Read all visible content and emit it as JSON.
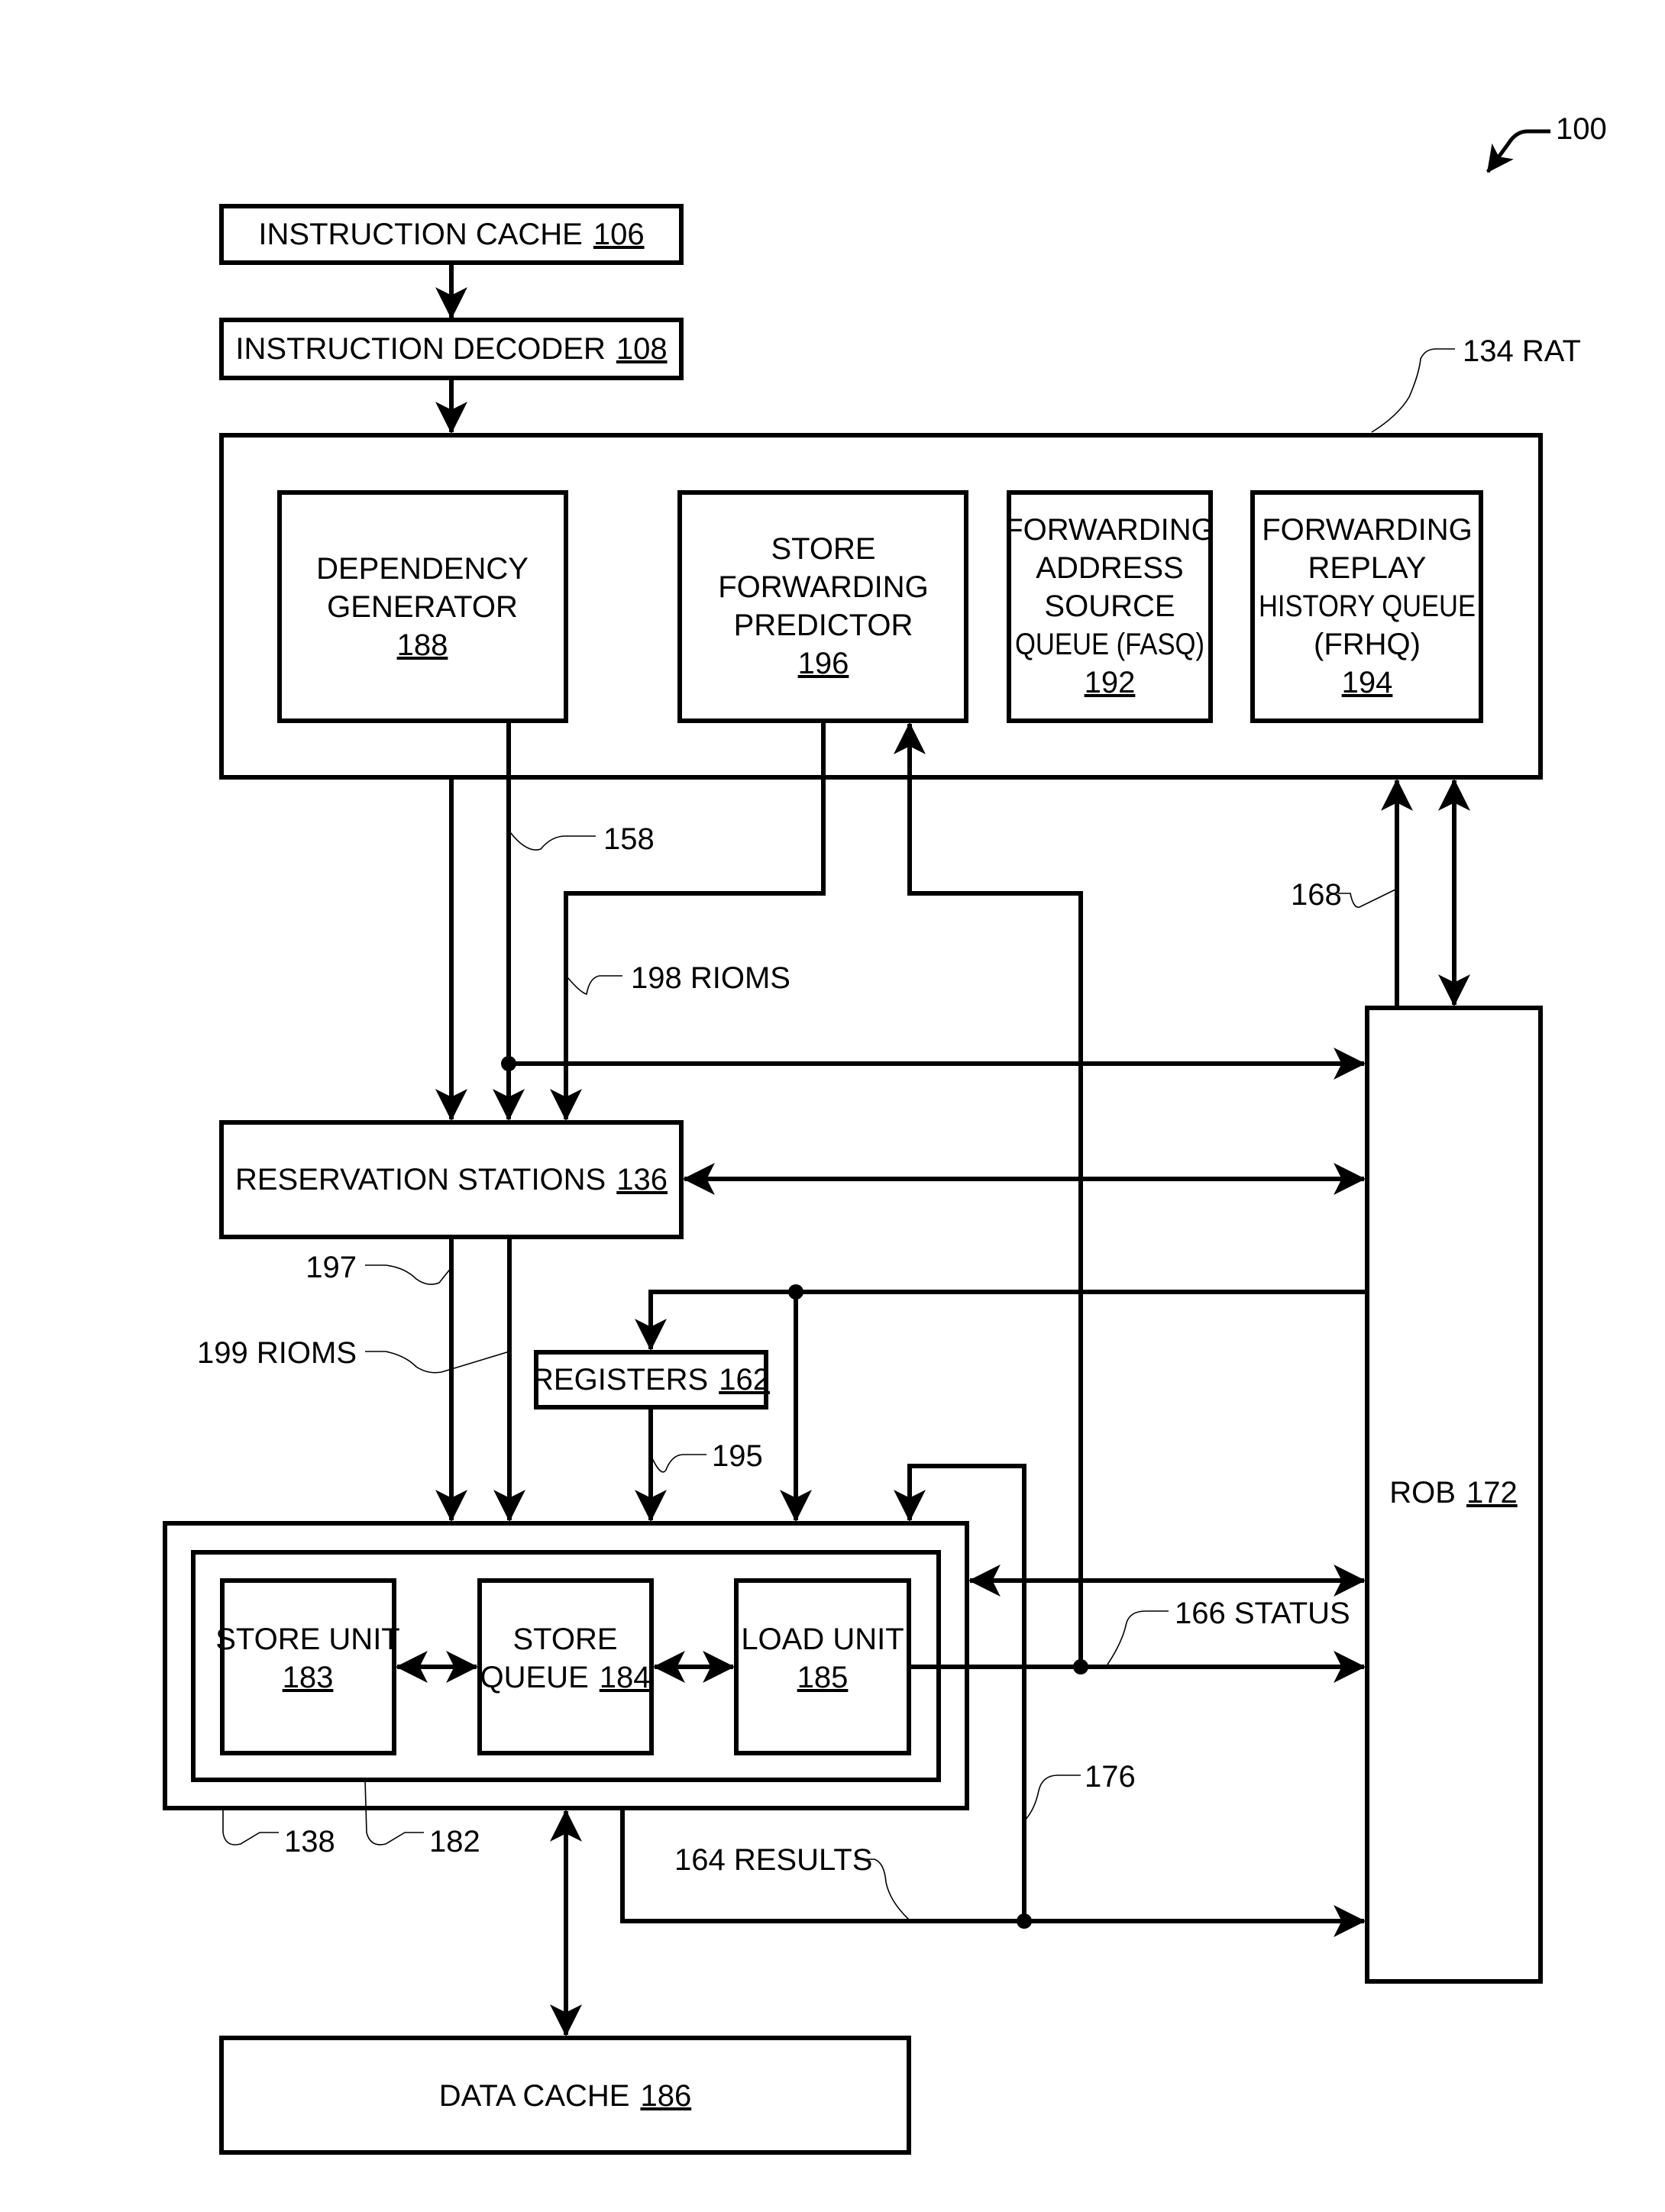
{
  "figure": {
    "figure_number": "100",
    "colors": {
      "line": "#000000",
      "background": "#ffffff"
    }
  },
  "blocks": {
    "instruction_cache": {
      "label": "INSTRUCTION CACHE",
      "ref": "106"
    },
    "instruction_decoder": {
      "label": "INSTRUCTION DECODER",
      "ref": "108"
    },
    "rat": {
      "callout": "134  RAT"
    },
    "dependency_generator": {
      "lines": [
        "DEPENDENCY",
        "GENERATOR"
      ],
      "ref": "188"
    },
    "store_forwarding_predictor": {
      "lines": [
        "STORE",
        "FORWARDING",
        "PREDICTOR"
      ],
      "ref": "196"
    },
    "fasq": {
      "lines": [
        "FORWARDING",
        "ADDRESS",
        "SOURCE",
        "QUEUE (FASQ)"
      ],
      "ref": "192"
    },
    "frhq": {
      "lines": [
        "FORWARDING",
        "REPLAY",
        "HISTORY QUEUE",
        "(FRHQ)"
      ],
      "ref": "194"
    },
    "reservation_stations": {
      "label": "RESERVATION STATIONS",
      "ref": "136"
    },
    "registers": {
      "label": "REGISTERS",
      "ref": "162"
    },
    "store_unit": {
      "lines": [
        "STORE UNIT"
      ],
      "ref": "183"
    },
    "store_queue": {
      "lines": [
        "STORE",
        "QUEUE"
      ],
      "ref": "184"
    },
    "load_unit": {
      "lines": [
        "LOAD UNIT"
      ],
      "ref": "185"
    },
    "data_cache": {
      "label": "DATA CACHE",
      "ref": "186"
    },
    "rob": {
      "label": "ROB",
      "ref": "172"
    }
  },
  "callouts": {
    "c158": "158",
    "c198": "198 RIOMS",
    "c168": "168",
    "c197": "197",
    "c199": "199 RIOMS",
    "c195": "195",
    "c166": "166 STATUS",
    "c176": "176",
    "c164": "164 RESULTS",
    "c138": "138",
    "c182": "182"
  }
}
